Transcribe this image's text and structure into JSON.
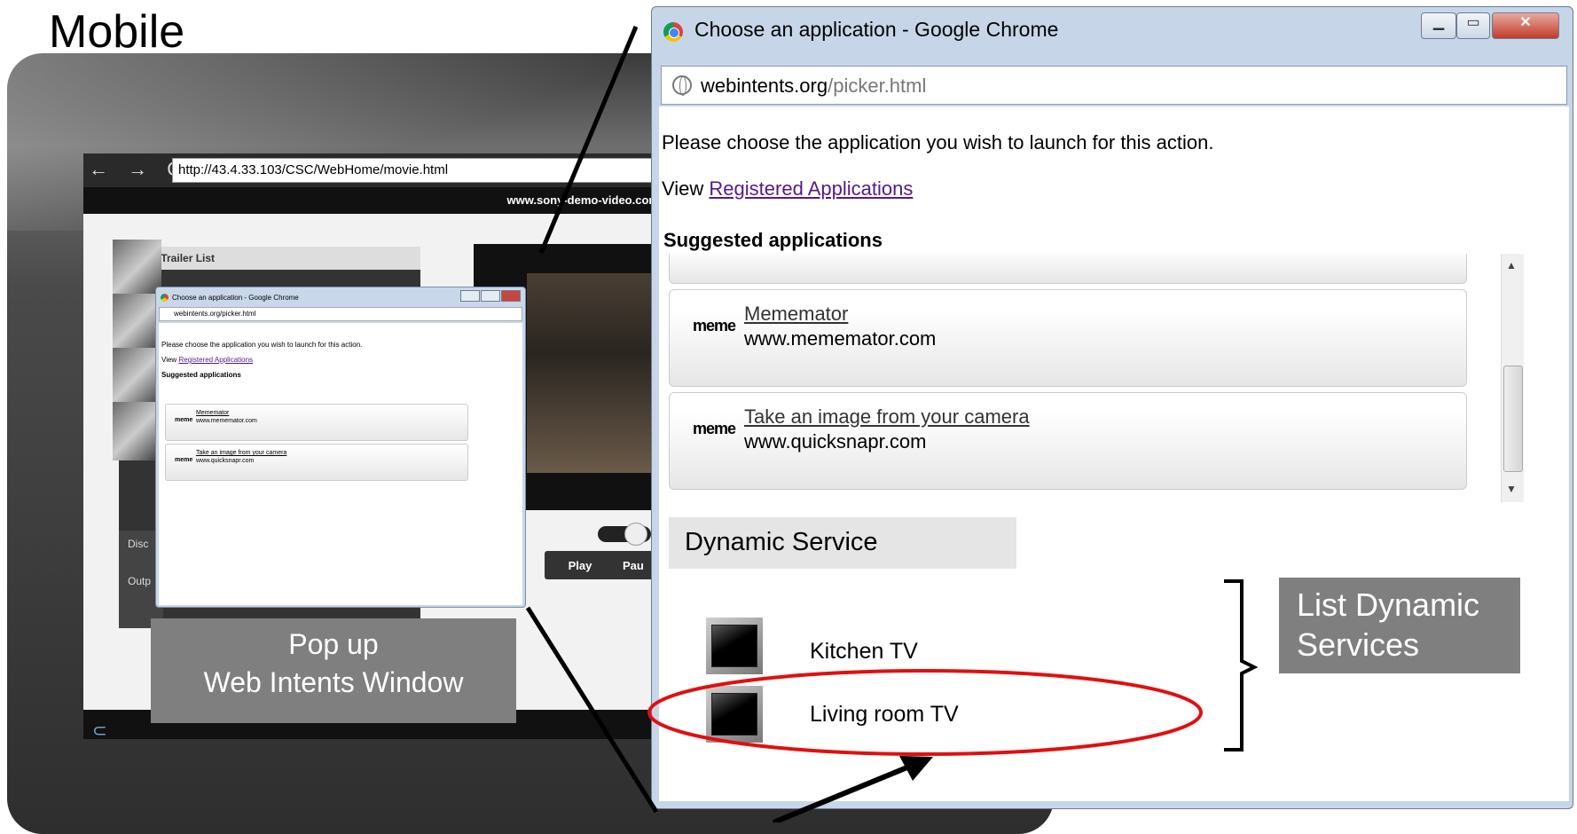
{
  "slide": {
    "title": "Mobile"
  },
  "tablet": {
    "nav": "← → C",
    "url": "http://43.4.33.103/CSC/WebHome/movie.html",
    "site_header": "www.sony-demo-video.com - Movie Trailer",
    "list_header": "Movie Trailer List",
    "discovery_label": "Disc",
    "output_label": "Outp",
    "play_label": "Play",
    "pause_label": "Pau"
  },
  "small_popup": {
    "title": "Choose an application - Google Chrome",
    "url": "webintents.org/picker.html",
    "prompt": "Please choose the application you wish to launch for this action.",
    "view_prefix": "View",
    "view_link": "Registered Applications",
    "suggested": "Suggested applications",
    "apps": [
      {
        "logo": "meme",
        "name": "Mememator",
        "url": "www.mememator.com"
      },
      {
        "logo": "meme",
        "name": "Take an image from your camera",
        "url": "www.quicksnapr.com"
      }
    ]
  },
  "callout": {
    "line1": "Pop up",
    "line2": "Web Intents Window"
  },
  "chrome_window": {
    "title": "Choose an application - Google Chrome",
    "url_host": "webintents.org",
    "url_path": "/picker.html",
    "prompt": "Please choose the application you wish to launch for this action.",
    "view_prefix": "View",
    "view_link": "Registered Applications",
    "suggested": "Suggested applications",
    "apps": [
      {
        "logo": "meme",
        "name": "Mememator",
        "url": "www.mememator.com"
      },
      {
        "logo": "meme",
        "name": "Take an image from your camera",
        "url": "www.quicksnapr.com"
      }
    ],
    "dynamic_header": "Dynamic Service",
    "dynamic_services": [
      {
        "name": "Kitchen TV"
      },
      {
        "name": "Living room TV"
      }
    ]
  },
  "dynamic_callout": {
    "line1": "List Dynamic",
    "line2": "Services"
  },
  "colors": {
    "highlight_ellipse": "#e01010",
    "callout_bg": "#7f7f7f",
    "link": "#551a8b"
  }
}
